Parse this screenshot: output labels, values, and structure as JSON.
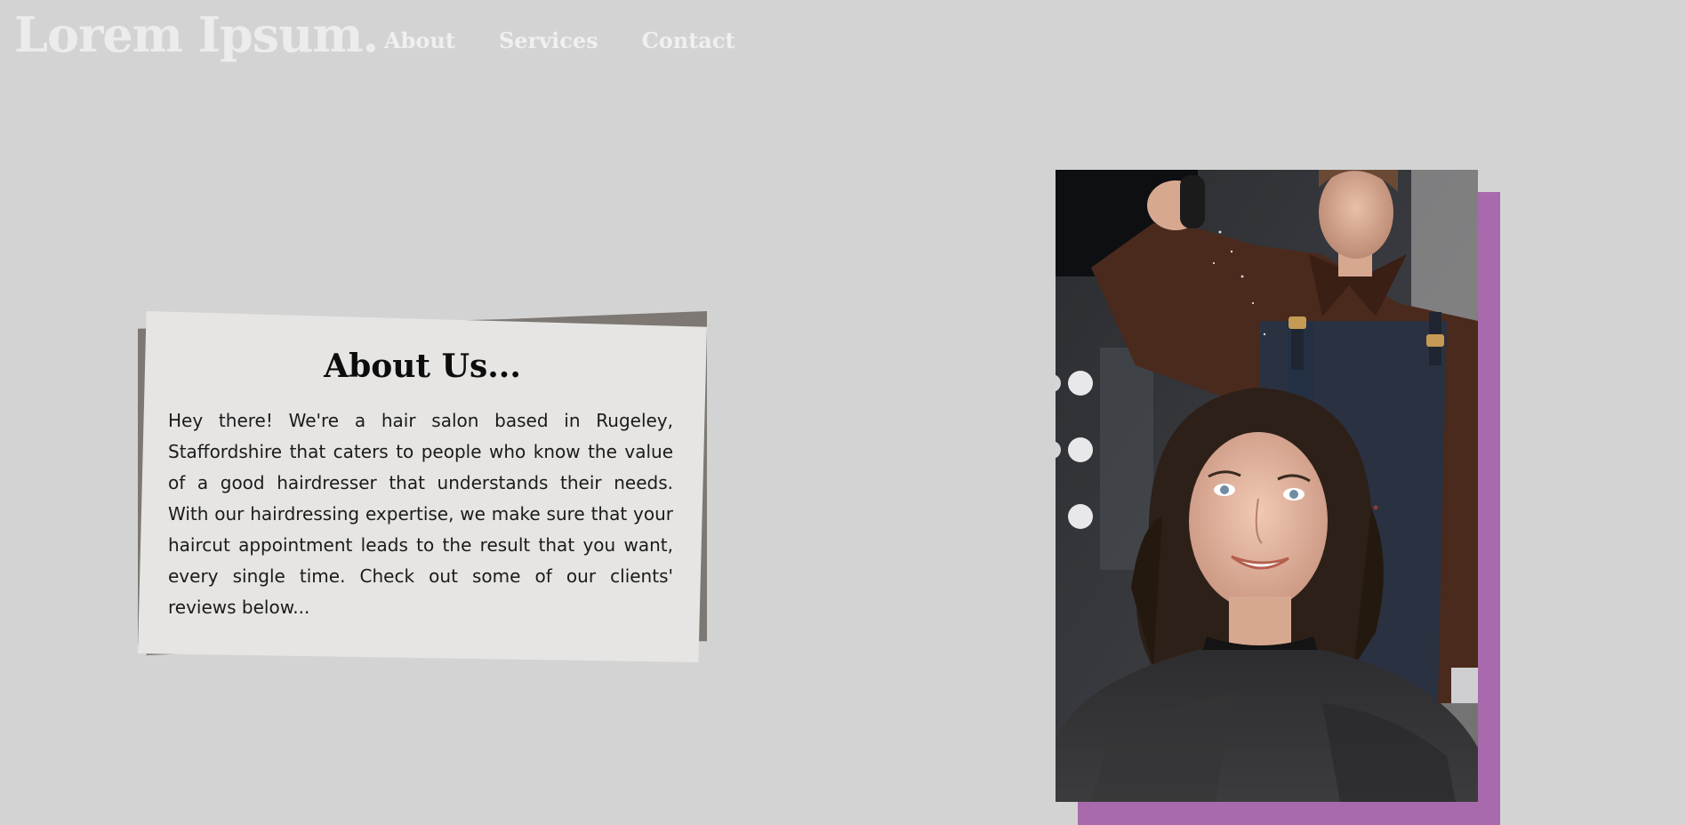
{
  "header": {
    "brand": "Lorem Ipsum.",
    "nav": [
      {
        "label": "About"
      },
      {
        "label": "Services"
      },
      {
        "label": "Contact"
      }
    ]
  },
  "about": {
    "title": "About Us...",
    "body": "Hey there! We're a hair salon based in Rugeley, Staffordshire that caters to people who know the value of a good hairdresser that understands their needs. With our hairdressing expertise, we make sure that your haircut appointment leads to the result that you want, every single time. Check out some of our clients' reviews below..."
  },
  "colors": {
    "background": "#d3d3d3",
    "card": "#e6e5e3",
    "card_shadow": "#7d7873",
    "accent": "#a86aad",
    "nav_text": "#f0f0f0"
  },
  "photo": {
    "subject": "hairdresser styling a smiling client's wavy dark hair in a salon"
  }
}
